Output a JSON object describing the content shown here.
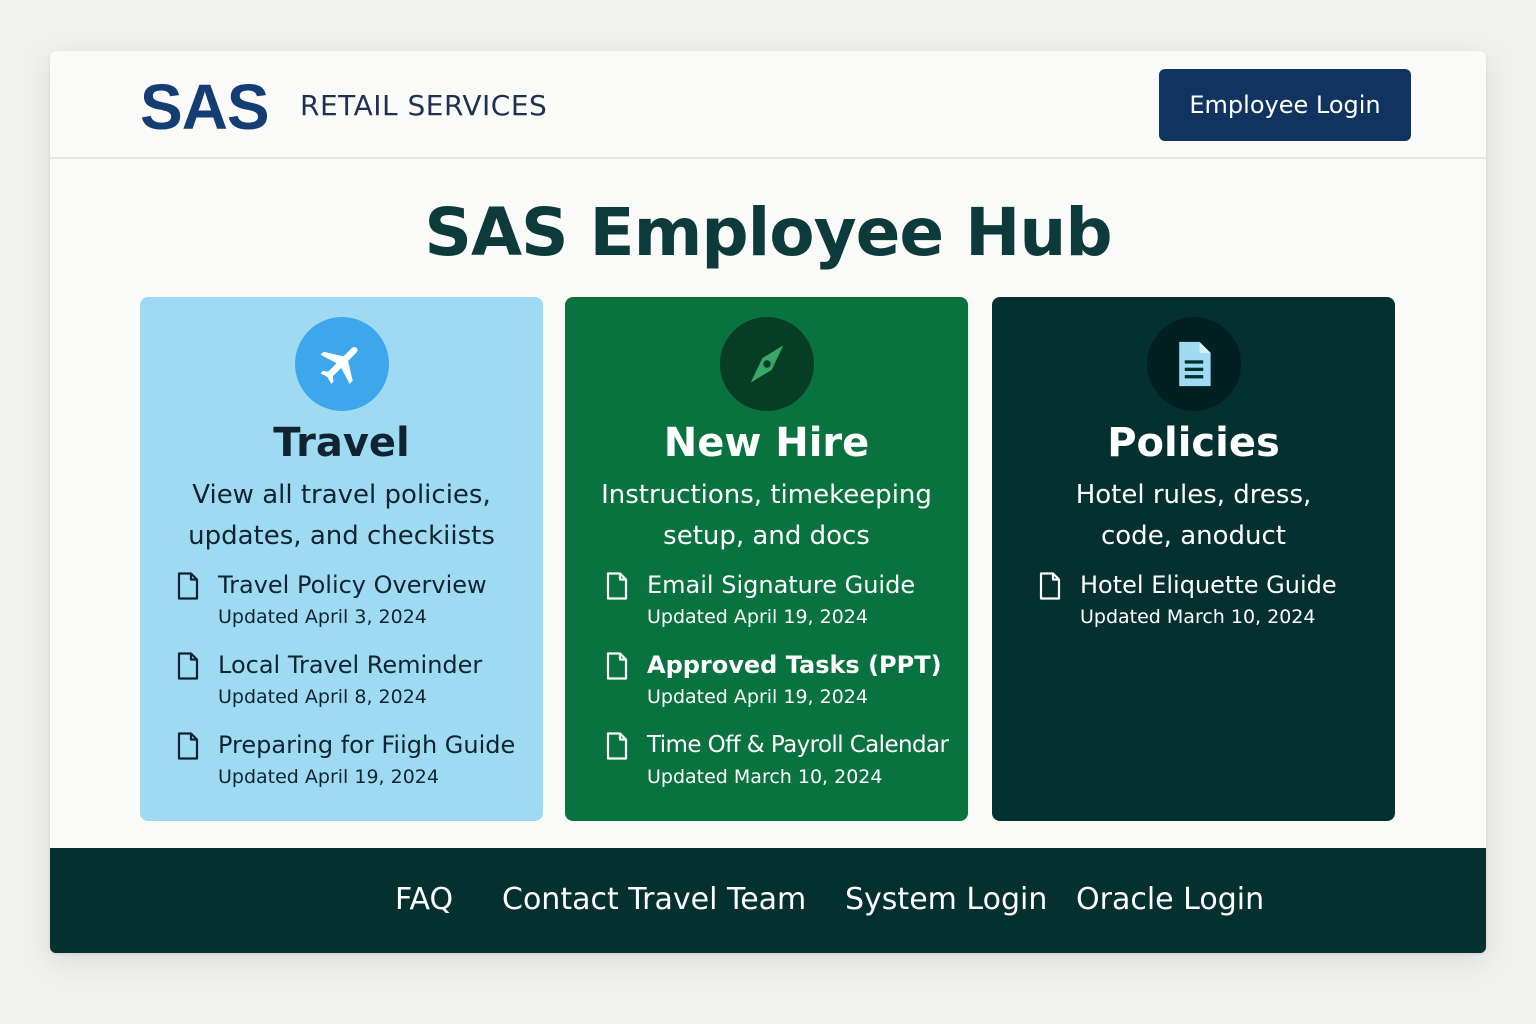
{
  "header": {
    "logo": "SAS",
    "tagline": "RETAIL SERVICES",
    "login_label": "Employee Login"
  },
  "page": {
    "title": "SAS Employee Hub"
  },
  "cards": [
    {
      "icon": "airplane-icon",
      "title": "Travel",
      "description": "View all travel policies, updates, and checkiists",
      "docs": [
        {
          "name": "Travel Policy Overview",
          "updated": "Updated April 3, 2024"
        },
        {
          "name": "Local Travel Reminder",
          "updated": "Updated April 8, 2024"
        },
        {
          "name": "Preparing for Fiigh Guide",
          "updated": "Updated April 19, 2024"
        }
      ]
    },
    {
      "icon": "compass-icon",
      "title": "New Hire",
      "description": "Instructions, timekeeping setup, and docs",
      "docs": [
        {
          "name": "Email Signature Guide",
          "updated": "Updated April 19, 2024"
        },
        {
          "name": "Approved Tasks (PPT)",
          "updated": "Updated April 19, 2024"
        },
        {
          "name": "Time Off & Payroll Calendar",
          "updated": "Updated March 10, 2024"
        }
      ]
    },
    {
      "icon": "document-icon",
      "title": "Policies",
      "description": "Hotel rules, dress, code, anoduct",
      "docs": [
        {
          "name": "Hotel Eliquette Guide",
          "updated": "Updated March 10, 2024"
        }
      ]
    }
  ],
  "footer": {
    "links": [
      "FAQ",
      "Contact Travel Team",
      "System Login",
      "Oracle Login"
    ]
  },
  "colors": {
    "brand_navy": "#143e73",
    "button_navy": "#103360",
    "travel_card": "#9edbf2",
    "newhire_card": "#097340",
    "policies_card": "#04302f",
    "footer": "#04302f",
    "title_text": "#0d3a3a"
  }
}
